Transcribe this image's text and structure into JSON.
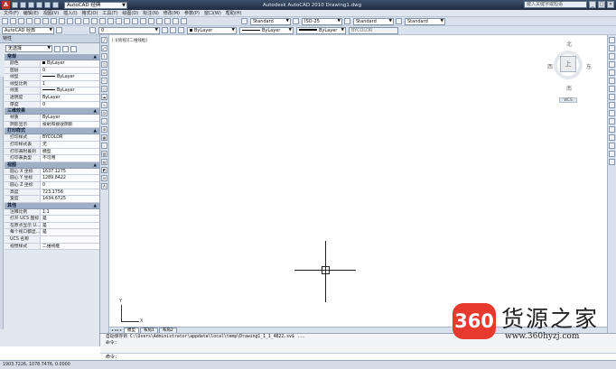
{
  "titlebar": {
    "logo": "A",
    "workspace": "AutoCAD 经典",
    "title": "Autodesk AutoCAD 2010  Drawing1.dwg",
    "search_placeholder": "键入关键字或短语"
  },
  "menubar": {
    "items": [
      "文件(F)",
      "编辑(E)",
      "视图(V)",
      "插入(I)",
      "格式(O)",
      "工具(T)",
      "绘图(D)",
      "标注(N)",
      "修改(M)",
      "参数(P)",
      "窗口(W)",
      "帮助(H)"
    ]
  },
  "toolbar1": {
    "text_style": "Standard",
    "dim_style": "ISO-25",
    "table_style": "Standard",
    "mleader_style": "Standard"
  },
  "toolbar2": {
    "workspace": "AutoCAD 经典",
    "layer": "0",
    "color": "ByLayer",
    "linetype": "ByLayer",
    "lineweight": "ByLayer",
    "plotstyle": "BYCOLOR",
    "visual_style": "■ 二维线框"
  },
  "palette": {
    "title": "特性",
    "selection": "无选择",
    "sections": [
      {
        "name": "常规",
        "rows": [
          {
            "k": "颜色",
            "v": "ByLayer",
            "kind": "swatch"
          },
          {
            "k": "图层",
            "v": "0"
          },
          {
            "k": "线型",
            "v": "ByLayer",
            "kind": "line"
          },
          {
            "k": "线型比例",
            "v": "1"
          },
          {
            "k": "线宽",
            "v": "ByLayer",
            "kind": "line"
          },
          {
            "k": "透明度",
            "v": "ByLayer"
          },
          {
            "k": "厚度",
            "v": "0"
          }
        ]
      },
      {
        "name": "三维效果",
        "rows": [
          {
            "k": "材质",
            "v": "ByLayer"
          },
          {
            "k": "阴影显示",
            "v": "投射和接收阴影"
          }
        ]
      },
      {
        "name": "打印样式",
        "rows": [
          {
            "k": "打印样式",
            "v": "BYCOLOR"
          },
          {
            "k": "打印样式表",
            "v": "无"
          },
          {
            "k": "打印表附着到",
            "v": "模型"
          },
          {
            "k": "打印表类型",
            "v": "不可用"
          }
        ]
      },
      {
        "name": "视图",
        "rows": [
          {
            "k": "圆心 X 坐标",
            "v": "1637.1275"
          },
          {
            "k": "圆心 Y 坐标",
            "v": "1289.8422"
          },
          {
            "k": "圆心 Z 坐标",
            "v": "0"
          },
          {
            "k": "高度",
            "v": "723.1756"
          },
          {
            "k": "宽度",
            "v": "1434.6725"
          }
        ]
      },
      {
        "name": "其他",
        "rows": [
          {
            "k": "注释比例",
            "v": "1:1"
          },
          {
            "k": "打开 UCS 图标",
            "v": "是"
          },
          {
            "k": "在原点显示 U...",
            "v": "是"
          },
          {
            "k": "每个视口都显...",
            "v": "是"
          },
          {
            "k": "UCS 名称",
            "v": ""
          },
          {
            "k": "视觉样式",
            "v": "二维线框"
          }
        ]
      }
    ]
  },
  "drawbar": {
    "tools": [
      "line-icon",
      "xline-icon",
      "polyline-icon",
      "polygon-icon",
      "rectangle-icon",
      "arc-icon",
      "circle-icon",
      "revcloud-icon",
      "spline-icon",
      "ellipse-icon",
      "ellipse-arc-icon",
      "insert-block-icon",
      "make-block-icon",
      "point-icon",
      "hatch-icon",
      "gradient-icon",
      "region-icon",
      "table-icon",
      "mtext-icon"
    ],
    "tool_glyphs": [
      "╱",
      "⤢",
      "⌇",
      "⬡",
      "▭",
      "◠",
      "○",
      "☁",
      "∿",
      "⬭",
      "◡",
      "⊞",
      "▦",
      "·",
      "▨",
      "▤",
      "◩",
      "⊟",
      "A"
    ]
  },
  "modbar": {
    "tools": [
      "erase-icon",
      "copy-icon",
      "mirror-icon",
      "offset-icon",
      "array-icon",
      "move-icon",
      "rotate-icon",
      "scale-icon",
      "stretch-icon",
      "trim-icon",
      "extend-icon",
      "break-icon",
      "join-icon",
      "chamfer-icon",
      "fillet-icon",
      "explode-icon"
    ]
  },
  "canvas": {
    "view_label": "[-][俯视][二维线框]",
    "ucs_x": "X",
    "ucs_y": "Y"
  },
  "viewcube": {
    "north": "北",
    "south": "南",
    "east": "东",
    "west": "西",
    "face": "上",
    "wcs": "WCS"
  },
  "tabs": {
    "nav": "◂ ◂ ▸ ▸",
    "items": [
      "模型",
      "布局1",
      "布局2"
    ]
  },
  "cmdwin": {
    "line1": "自动保存到 C:\\Users\\Administrator\\appdata\\local\\temp\\Drawing1_1_1_4822.sv$ ...",
    "line2": "命令:",
    "input": "命令:"
  },
  "statusbar": {
    "coords": "1903.7226, 1078.7476, 0.0000"
  },
  "watermark": {
    "badge": "360",
    "brand": "货源之家",
    "url": "www.360hyzj.com"
  }
}
